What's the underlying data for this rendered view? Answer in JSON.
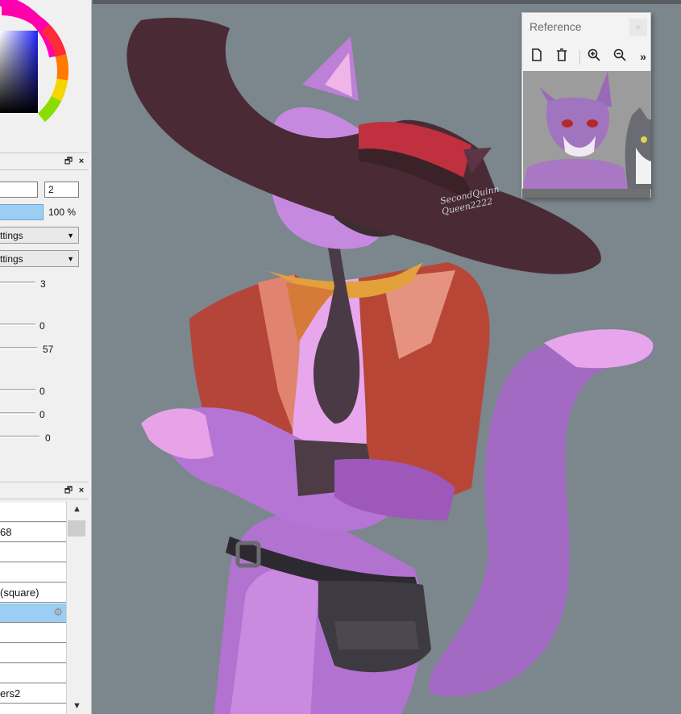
{
  "left_panel": {
    "value_field": "2",
    "opacity_text": "100 %",
    "dropdown_1": "ttings",
    "dropdown_2": "ttings",
    "sliders": [
      "3",
      "0",
      "57",
      "0",
      "0",
      "0"
    ],
    "list_items": [
      "",
      "68",
      "",
      "",
      "(square)",
      "",
      "",
      "",
      "",
      "ers2",
      ""
    ]
  },
  "reference": {
    "title": "Reference",
    "close_glyph": "×",
    "more_glyph": "»"
  },
  "canvas": {
    "signature_line1": "SecondQuinn",
    "signature_line2": "Queen2222"
  },
  "colors": {
    "canvas_bg": "#7b868d",
    "panel_bg": "#f0f0f0",
    "selection": "#9ccdf2"
  }
}
